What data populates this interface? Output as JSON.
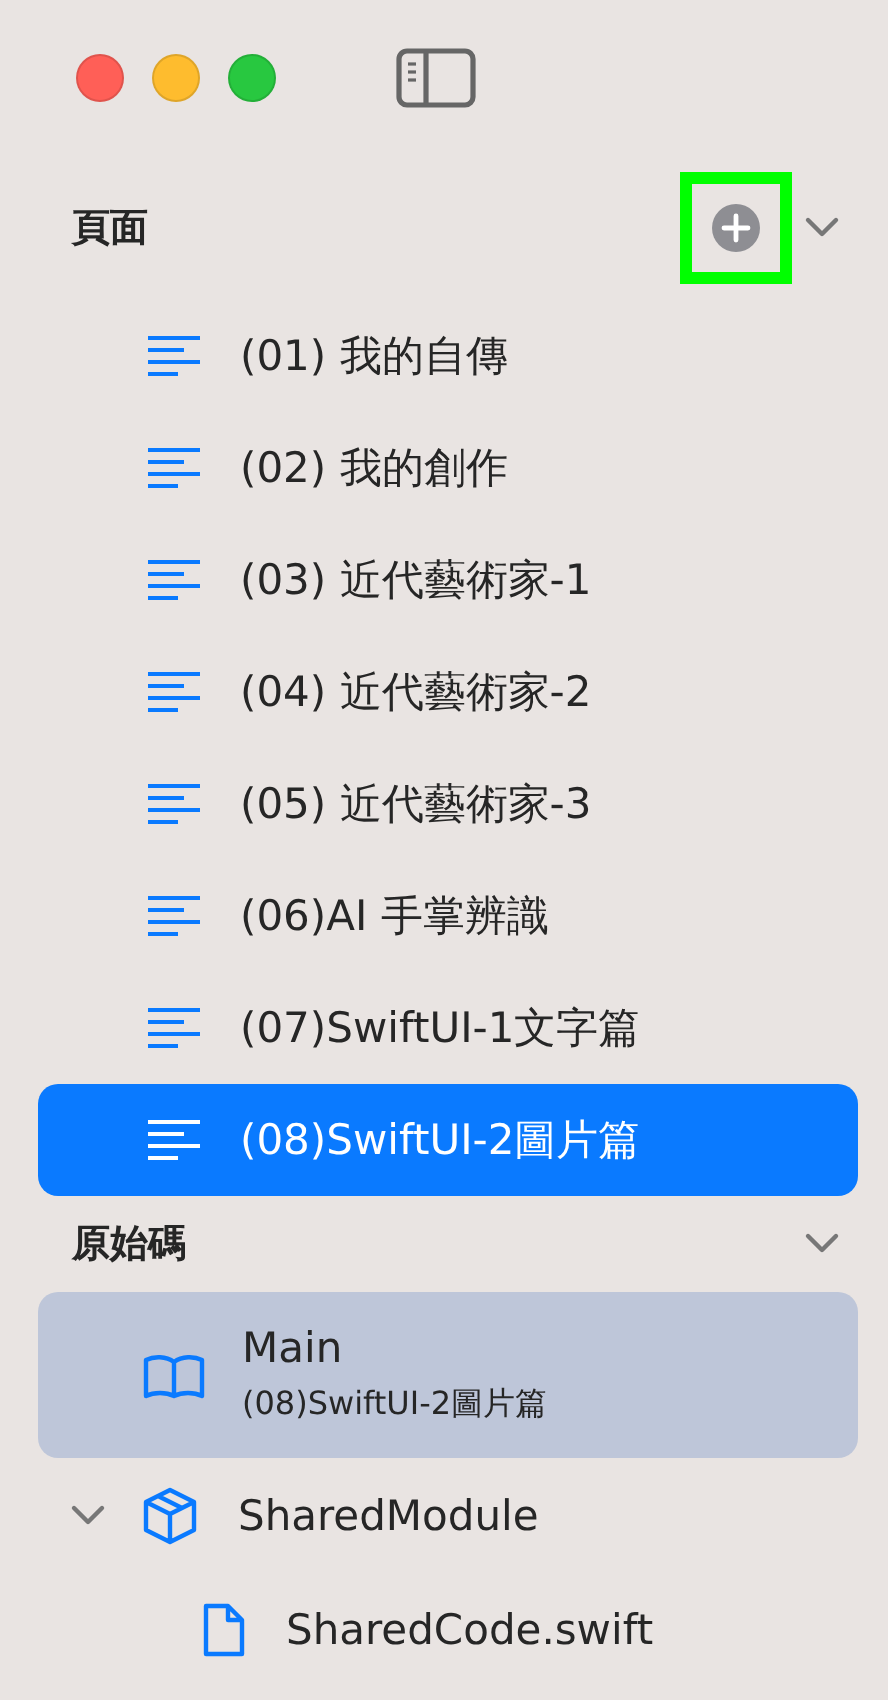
{
  "window": {
    "controls": [
      {
        "kind": "close"
      },
      {
        "kind": "minimize"
      },
      {
        "kind": "zoom"
      }
    ]
  },
  "pages": {
    "title": "頁面",
    "add_highlighted": true,
    "expanded": true,
    "items": [
      {
        "label": "(01) 我的自傳",
        "selected": false
      },
      {
        "label": "(02) 我的創作",
        "selected": false
      },
      {
        "label": "(03) 近代藝術家-1",
        "selected": false
      },
      {
        "label": "(04) 近代藝術家-2",
        "selected": false
      },
      {
        "label": "(05) 近代藝術家-3",
        "selected": false
      },
      {
        "label": "(06)AI 手掌辨識",
        "selected": false
      },
      {
        "label": "(07)SwiftUI-1文字篇",
        "selected": false
      },
      {
        "label": "(08)SwiftUI-2圖片篇",
        "selected": true
      }
    ]
  },
  "source": {
    "title": "原始碼",
    "expanded": true,
    "items": [
      {
        "kind": "book",
        "label": "Main",
        "subtitle": "(08)SwiftUI-2圖片篇",
        "selected": true
      },
      {
        "kind": "module",
        "label": "SharedModule",
        "selected": false,
        "expanded": true,
        "children": [
          {
            "kind": "file",
            "label": "SharedCode.swift",
            "selected": false
          }
        ]
      }
    ]
  }
}
